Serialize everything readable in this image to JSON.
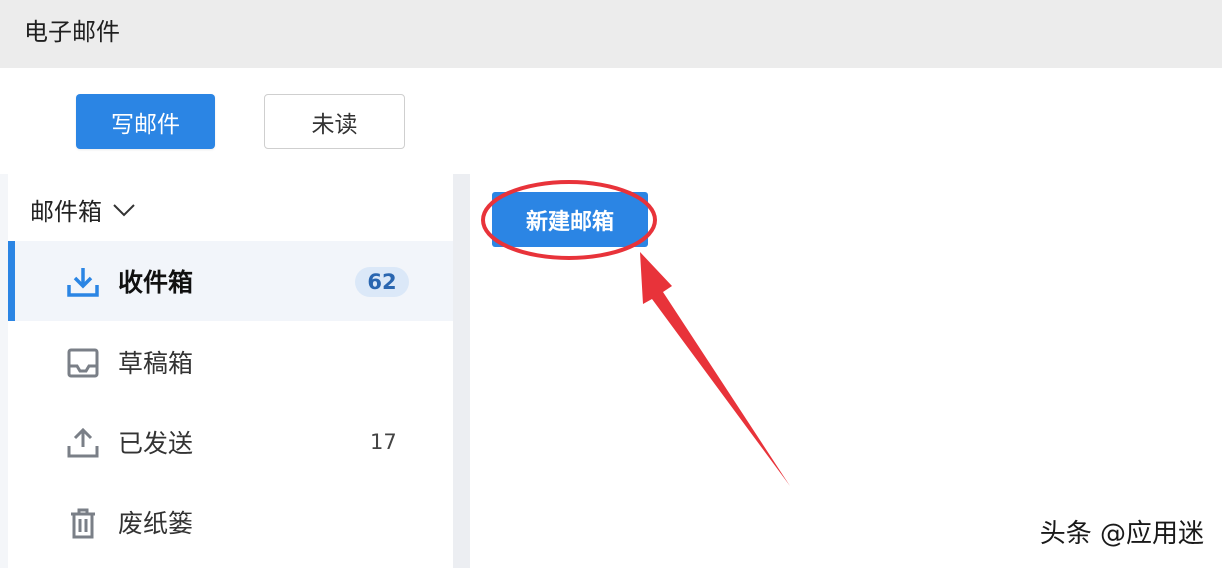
{
  "window": {
    "title": "电子邮件"
  },
  "toolbar": {
    "compose_label": "写邮件",
    "unread_label": "未读"
  },
  "sidebar": {
    "header": "邮件箱",
    "items": [
      {
        "label": "收件箱",
        "icon": "inbox-download-icon",
        "badge": "62",
        "active": true
      },
      {
        "label": "草稿箱",
        "icon": "drafts-tray-icon",
        "count": "",
        "active": false
      },
      {
        "label": "已发送",
        "icon": "sent-upload-icon",
        "count": "17",
        "active": false
      },
      {
        "label": "废纸篓",
        "icon": "trash-icon",
        "count": "",
        "active": false
      }
    ]
  },
  "content": {
    "new_mailbox_label": "新建邮箱"
  },
  "annotation": {
    "highlight_color": "#e8333a"
  },
  "watermark": "头条 @应用迷",
  "colors": {
    "accent": "#2b85e4",
    "badge_bg": "#dbe8f8",
    "badge_text": "#2a66b0"
  }
}
